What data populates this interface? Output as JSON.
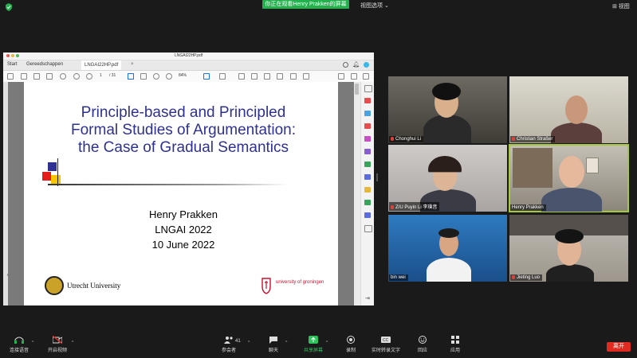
{
  "topbar": {
    "banner": "你正在观看Henry  Prakken的屏幕",
    "view_options": "视图选项 ⌄",
    "view_button": "⊞ 视图"
  },
  "pdf": {
    "file_title": "LNGAI22HP.pdf",
    "tabs": [
      "Start",
      "Gereedschappen",
      "LNGAI22HP.pdf"
    ],
    "page_current": "1",
    "page_total": "/ 31",
    "zoom": "84%",
    "slide": {
      "title": "Principle-based and Principled Formal Studies of Argumentation: the Case of Gradual Semantics",
      "author": "Henry Prakken",
      "event": "LNGAI 2022",
      "date": "10 June 2022",
      "uu_logo_text": "Utrecht University",
      "rug_logo_text": "university of groningen"
    }
  },
  "participants": [
    {
      "name": "Chonghui Li",
      "muted": true
    },
    {
      "name": "Christian Straßer",
      "muted": true
    },
    {
      "name": "Z/U Puyin Li 李璞音",
      "muted": true
    },
    {
      "name": "Henry Prakken",
      "muted": false,
      "active_speaker": true
    },
    {
      "name": "bin wei",
      "muted": false
    },
    {
      "name": "Jieting Luo",
      "muted": true
    }
  ],
  "toolbar": {
    "audio": "连接语音",
    "video": "开启视频",
    "participants_count": "41",
    "participants": "参会者",
    "chat": "聊天",
    "share": "共享屏幕",
    "record": "录制",
    "captions": "实时转录文字",
    "reactions": "回应",
    "apps": "应用",
    "leave": "离开"
  },
  "colors": {
    "accent_green": "#23b14d",
    "leave_red": "#e02b20",
    "slide_title_blue": "#2e3192",
    "active_speaker_outline": "#a6c93a"
  }
}
